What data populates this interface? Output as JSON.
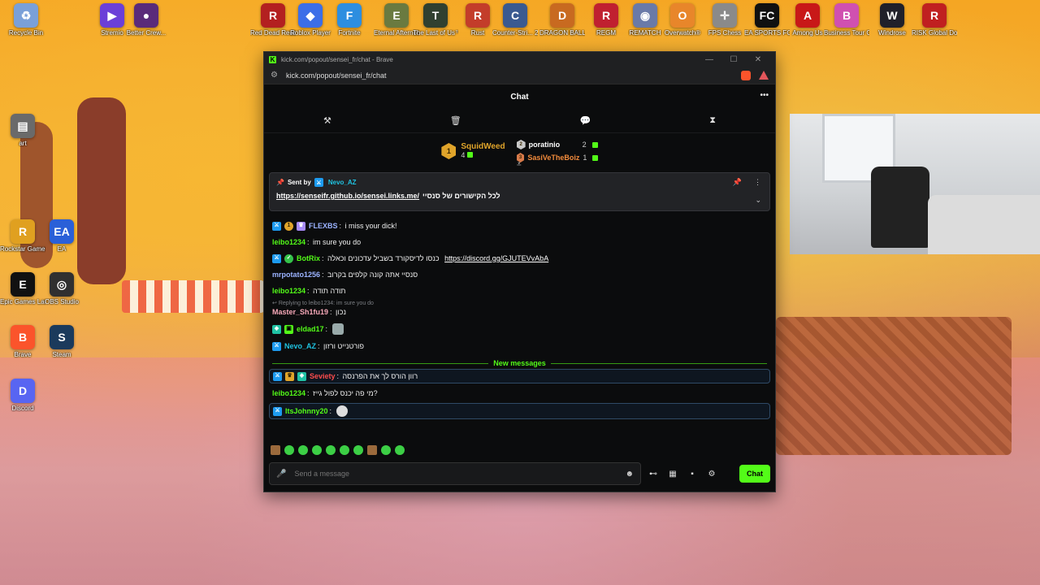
{
  "desktop": {
    "top_icons": [
      {
        "label": "Recycle Bin",
        "color": "#7aa0d8",
        "glyph": "♻"
      },
      {
        "label": "Stremio",
        "color": "#6b3fd8",
        "glyph": "▶"
      },
      {
        "label": "Better Crew...",
        "color": "#5a2b7a",
        "glyph": "●"
      },
      {
        "label": "Red Dead Redempti...",
        "color": "#b32020",
        "glyph": "R"
      },
      {
        "label": "Roblox Player",
        "color": "#3c6ee8",
        "glyph": "◆"
      },
      {
        "label": "Fortnite",
        "color": "#2d8ee0",
        "glyph": "F"
      },
      {
        "label": "Eternal Afternoon",
        "color": "#6a7a40",
        "glyph": "E"
      },
      {
        "label": "The Last of Us™ Part I",
        "color": "#304030",
        "glyph": "T"
      },
      {
        "label": "Rust",
        "color": "#c33d2a",
        "glyph": "R"
      },
      {
        "label": "Counter-Stri... 2",
        "color": "#3a5a90",
        "glyph": "C"
      },
      {
        "label": "DRAGON BALL Z ...",
        "color": "#c86a20",
        "glyph": "D"
      },
      {
        "label": "REGM",
        "color": "#c02030",
        "glyph": "R"
      },
      {
        "label": "REMATCH",
        "color": "#6a7aa8",
        "glyph": "◉"
      },
      {
        "label": "Overwatch®",
        "color": "#e8862a",
        "glyph": "O"
      },
      {
        "label": "FPS Chess",
        "color": "#8a8a8a",
        "glyph": "✛"
      },
      {
        "label": "EA SPORTS FC 26",
        "color": "#111111",
        "glyph": "FC"
      },
      {
        "label": "Among Us",
        "color": "#c81818",
        "glyph": "A"
      },
      {
        "label": "Business Tour Online M...",
        "color": "#d050b0",
        "glyph": "B"
      },
      {
        "label": "Windrose",
        "color": "#20202a",
        "glyph": "W"
      },
      {
        "label": "RISK Global Domination",
        "color": "#c02020",
        "glyph": "R"
      }
    ],
    "left_icons": [
      {
        "label": "art",
        "color": "#6a6a6a",
        "glyph": "▤"
      },
      {
        "label": "Rockstar Games...",
        "color": "#e0a020",
        "glyph": "R"
      },
      {
        "label": "EA",
        "color": "#2a60d8",
        "glyph": "EA"
      },
      {
        "label": "Epic Games Launcher",
        "color": "#111111",
        "glyph": "E"
      },
      {
        "label": "OBS Studio",
        "color": "#303030",
        "glyph": "◎"
      },
      {
        "label": "Brave",
        "color": "#fb542b",
        "glyph": "B"
      },
      {
        "label": "Steam",
        "color": "#1b3a5c",
        "glyph": "S"
      },
      {
        "label": "Discord",
        "color": "#5865f2",
        "glyph": "D"
      }
    ]
  },
  "window": {
    "title": "kick.com/popout/sensei_fr/chat - Brave",
    "url": "kick.com/popout/sensei_fr/chat",
    "controls": {
      "minimize": "—",
      "maximize": "☐",
      "close": "✕"
    }
  },
  "chat": {
    "header_title": "Chat",
    "more_icon": "•••",
    "toolbar_icons": [
      "hammer-icon",
      "trash-icon",
      "chat-bubble-icon",
      "hourglass-icon"
    ],
    "leaderboard": {
      "first": {
        "rank": "1",
        "name": "SquidWeed",
        "count": "4"
      },
      "second": {
        "rank": "2",
        "name": "poratinio",
        "count": "2"
      },
      "third": {
        "rank": "3",
        "name": "SasiVeTheBoiz",
        "count": "1"
      }
    },
    "pinned": {
      "sent_by_label": "Sent by",
      "sender": "Nevo_AZ",
      "text": "לכל הקישורים של סנסיי",
      "link": "https://senseifr.github.io/sensei.links.me/"
    },
    "messages": [
      {
        "user": "FLEXBS",
        "color": "#9bb3ff",
        "text": "i miss your dick!"
      },
      {
        "user": "leibo1234",
        "color": "#53fc18",
        "text": "im sure you do"
      },
      {
        "user": "BotRix",
        "color": "#53fc18",
        "text": "כנסו לדיסקורד בשביל עדכונים וכאלה",
        "link": "https://discord.gg/GJUTEVvAbA"
      },
      {
        "user": "mrpotato1256",
        "color": "#9bb3ff",
        "text": "סנסיי אתה קונה קלפים בקרוב"
      },
      {
        "user": "leibo1234",
        "color": "#53fc18",
        "text": "תודה תודה"
      },
      {
        "reply": "Replying to leibo1234: im sure you do",
        "user": "Master_Sh1fu19",
        "color": "#f7a8b8",
        "text": "נכון"
      },
      {
        "user": "eldad17",
        "color": "#53fc18",
        "text": ""
      },
      {
        "user": "Nevo_AZ",
        "color": "#1fc2e0",
        "text": "פורטנייט ורזון"
      }
    ],
    "new_messages_label": "New messages",
    "new_messages": [
      {
        "user": "Seviety",
        "color": "#ff4d4d",
        "text": "רוון הורס לך את הפרנסה",
        "highlight": true
      },
      {
        "user": "leibo1234",
        "color": "#53fc18",
        "text": "מי פה יכנס לפול גייז?",
        "highlight": false
      },
      {
        "user": "ItsJohnny20",
        "color": "#53fc18",
        "text": "",
        "highlight": true
      }
    ],
    "input_placeholder": "Send a message",
    "send_label": "Chat"
  }
}
